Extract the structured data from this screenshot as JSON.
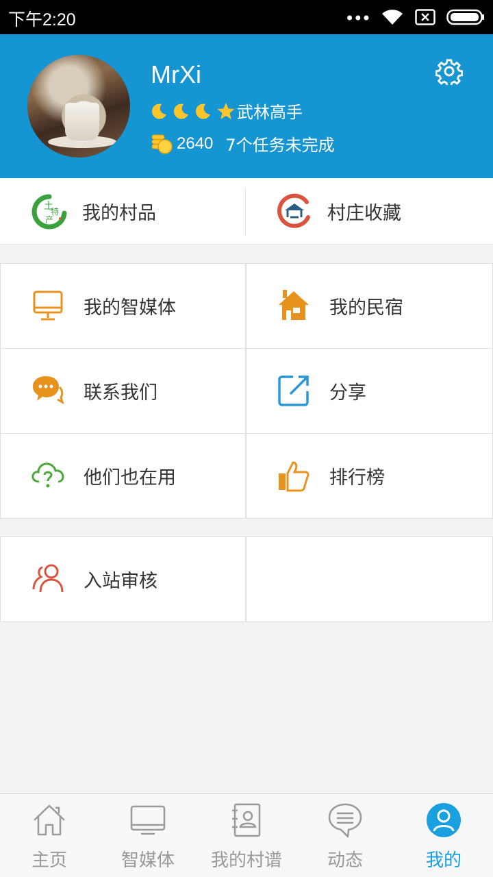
{
  "status_bar": {
    "time": "下午2:20",
    "dots": "•••"
  },
  "profile": {
    "username": "MrXi",
    "level_title": "武林高手",
    "coins": "2640",
    "tasks": "7个任务未完成"
  },
  "quick_links": [
    {
      "label": "我的村品",
      "icon": "village-products-icon"
    },
    {
      "label": "村庄收藏",
      "icon": "village-collection-icon"
    }
  ],
  "menu": [
    {
      "label": "我的智媒体",
      "icon": "monitor-icon"
    },
    {
      "label": "我的民宿",
      "icon": "house-icon"
    },
    {
      "label": "联系我们",
      "icon": "chat-icon"
    },
    {
      "label": "分享",
      "icon": "share-icon"
    },
    {
      "label": "他们也在用",
      "icon": "cloud-question-icon"
    },
    {
      "label": "排行榜",
      "icon": "thumbs-up-icon"
    }
  ],
  "menu2": [
    {
      "label": "入站审核",
      "icon": "users-icon"
    }
  ],
  "bottom_nav": [
    {
      "label": "主页",
      "icon": "home-icon",
      "active": false
    },
    {
      "label": "智媒体",
      "icon": "tv-icon",
      "active": false
    },
    {
      "label": "我的村谱",
      "icon": "contacts-icon",
      "active": false
    },
    {
      "label": "动态",
      "icon": "message-icon",
      "active": false
    },
    {
      "label": "我的",
      "icon": "profile-icon",
      "active": true
    }
  ],
  "colors": {
    "header_bg": "#1695d3",
    "active_tab": "#1aa0e0",
    "icon_orange": "#e8921e",
    "icon_blue": "#2a98d8",
    "icon_green": "#4aa83a",
    "icon_red": "#d9533f"
  }
}
